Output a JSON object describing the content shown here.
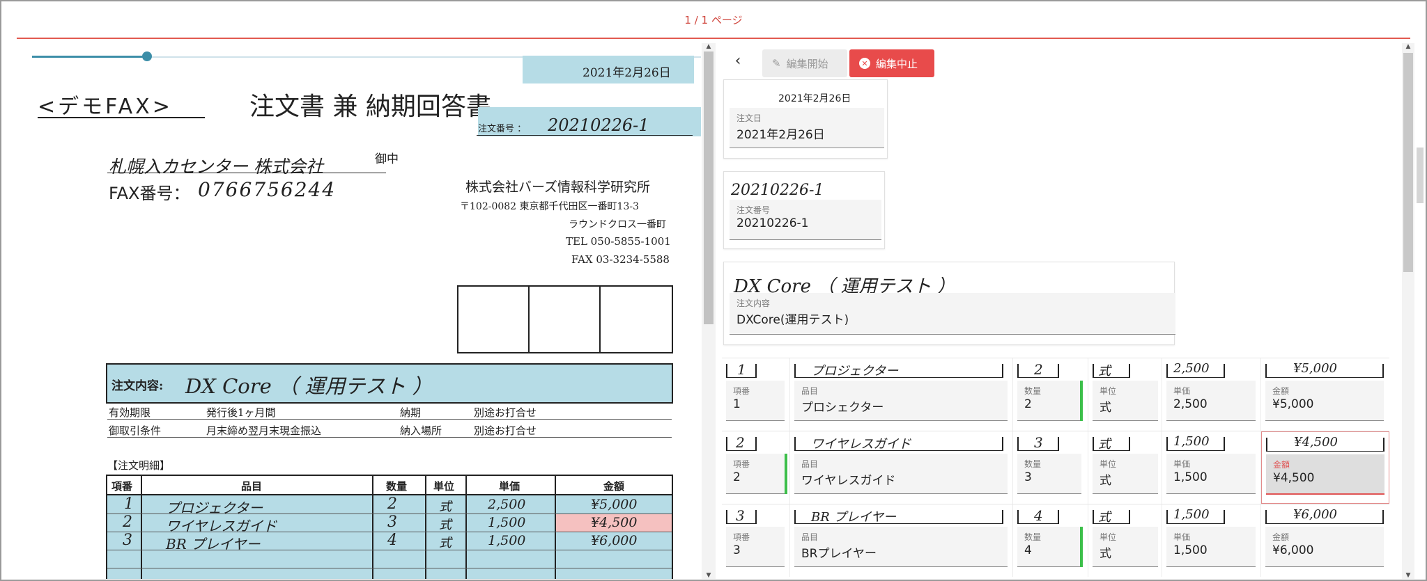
{
  "pager": {
    "label": "1 / 1 ページ"
  },
  "fax": {
    "date": "2021年2月26日",
    "brand": "<デモFAX>",
    "title": "注文書 兼 納期回答書",
    "order_no_label": "注文番号 ：",
    "order_no_hand": "20210226-1",
    "recipient_hand": "札幌入カセンター 株式会社",
    "honorific": "御中",
    "fax_label": "FAX番号：",
    "fax_hand": "0766756244",
    "company": "株式会社バーズ情報科学研究所",
    "address1": "〒102-0082 東京都千代田区一番町13-3",
    "address2": "ラウンドクロス一番町",
    "tel": "TEL 050-5855-1001",
    "faxno": "FAX 03-3234-5588",
    "content_label": "注文内容:",
    "content_hand": "DX Core （ 運用テスト ）",
    "valid_label": "有効期限",
    "valid_value": "発行後1ヶ月間",
    "due_label": "納期",
    "due_value": "別途お打合せ",
    "terms_label": "御取引条件",
    "terms_value": "月末締め翌月末現金振込",
    "place_label": "納入場所",
    "place_value": "別途お打合せ",
    "detail_heading": "【注文明細】",
    "columns": [
      "項番",
      "品目",
      "数量",
      "単位",
      "単価",
      "金額"
    ],
    "rows": [
      {
        "no": "1",
        "item": "プロジェクター",
        "qty": "2",
        "unit": "式",
        "price": "2,500",
        "amount": "¥5,000"
      },
      {
        "no": "2",
        "item": "ワイヤレスガイド",
        "qty": "3",
        "unit": "式",
        "price": "1,500",
        "amount": "¥4,500"
      },
      {
        "no": "3",
        "item": "BR プレイヤー",
        "qty": "4",
        "unit": "式",
        "price": "1,500",
        "amount": "¥6,000"
      }
    ]
  },
  "toolbar": {
    "back_icon": "chevron-left-icon",
    "edit_start": "編集開始",
    "edit_stop": "編集中止"
  },
  "form": {
    "order_date": {
      "snippet": "2021年2月26日",
      "label": "注文日",
      "value": "2021年2月26日"
    },
    "order_no": {
      "snippet": "20210226-1",
      "label": "注文番号",
      "value": "20210226-1"
    },
    "content": {
      "snippet": "DX Core （ 運用テスト ）",
      "label": "注文内容",
      "value": "DXCore(運用テスト)"
    },
    "labels": {
      "no": "項番",
      "item": "品目",
      "qty": "数量",
      "unit": "単位",
      "price": "単価",
      "amount": "金額"
    },
    "rows": [
      {
        "no_snip": "1",
        "item_snip": "プロジェクター",
        "qty_snip": "2",
        "unit_snip": "式",
        "price_snip": "2,500",
        "amount_snip": "¥5,000",
        "no": "1",
        "item": "プロシェクター",
        "qty": "2",
        "unit": "式",
        "price": "2,500",
        "amount": "¥5,000"
      },
      {
        "no_snip": "2",
        "item_snip": "ワイヤレスガイド",
        "qty_snip": "3",
        "unit_snip": "式",
        "price_snip": "1,500",
        "amount_snip": "¥4,500",
        "no": "2",
        "item": "ワイヤレスガイド",
        "qty": "3",
        "unit": "式",
        "price": "1,500",
        "amount": "¥4,500"
      },
      {
        "no_snip": "3",
        "item_snip": "BR プレイヤー",
        "qty_snip": "4",
        "unit_snip": "式",
        "price_snip": "1,500",
        "amount_snip": "¥6,000",
        "no": "3",
        "item": "BRプレイヤー",
        "qty": "4",
        "unit": "式",
        "price": "1,500",
        "amount": "¥6,000"
      }
    ]
  },
  "colors": {
    "accent_red": "#e84b4b",
    "highlight_blue": "#b6dce6",
    "highlight_red": "#f5c1c0",
    "valid_green": "#3cbf4a"
  }
}
